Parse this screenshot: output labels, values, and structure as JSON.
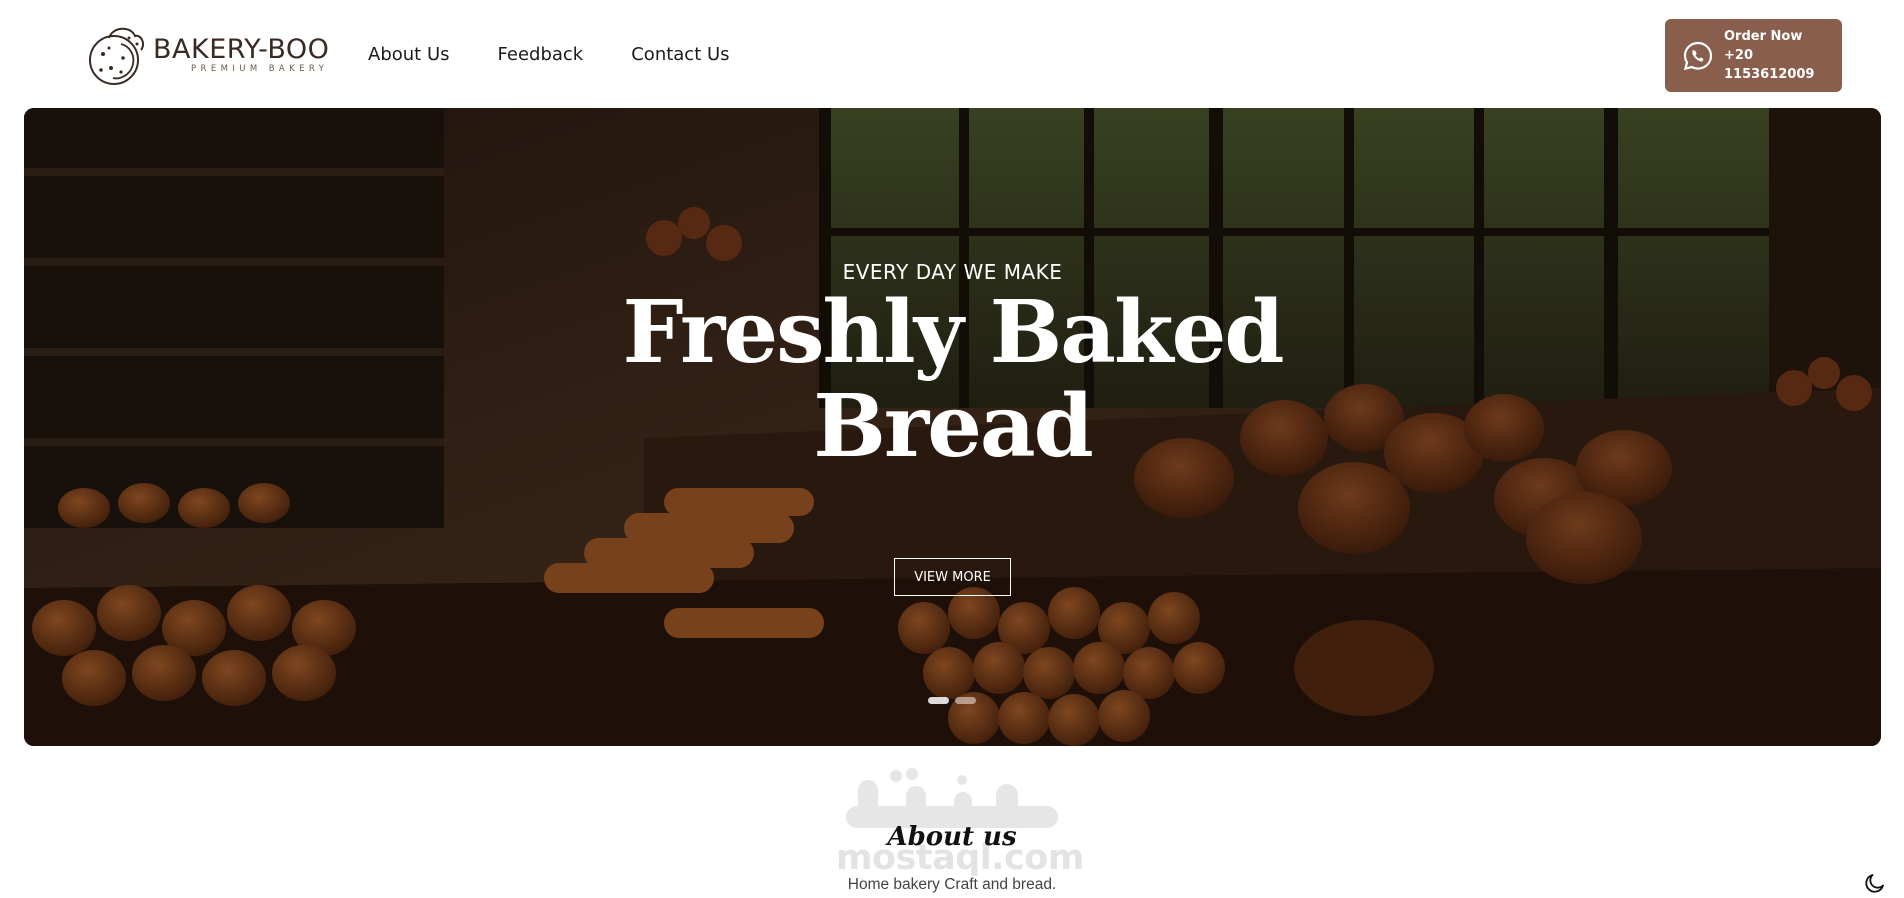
{
  "brand": {
    "name": "BAKERY-BOO",
    "tagline": "PREMIUM BAKERY"
  },
  "nav": {
    "links": [
      "About Us",
      "Feedback",
      "Contact Us"
    ]
  },
  "order": {
    "label": "Order Now",
    "phone": "+20 1153612009",
    "icon": "whatsapp-icon"
  },
  "hero": {
    "kicker": "EVERY DAY WE MAKE",
    "title_line1": "Freshly Baked",
    "title_line2": "Bread",
    "button": "VIEW MORE",
    "slides": 2,
    "active_slide": 1
  },
  "about": {
    "title": "About us",
    "subtitle": "Home bakery Craft and bread.",
    "watermark": "mostaql.com"
  },
  "theme_toggle_icon": "moon-icon",
  "colors": {
    "accent": "#8a5e4c",
    "text": "#1b1b1b"
  }
}
